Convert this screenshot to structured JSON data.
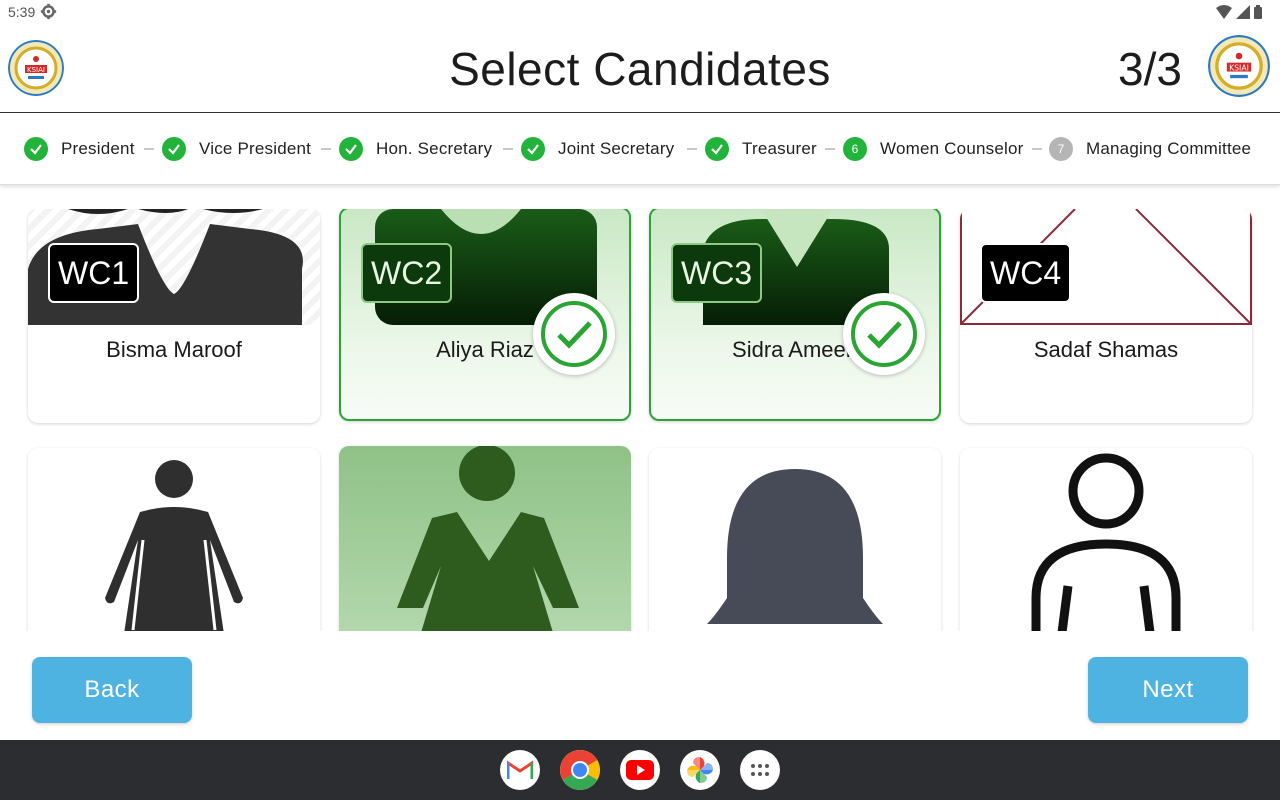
{
  "status_bar": {
    "time": "5:39"
  },
  "header": {
    "title": "Select Candidates",
    "page_count": "3/3"
  },
  "stepper": {
    "steps": [
      {
        "label": "President",
        "state": "done"
      },
      {
        "label": "Vice President",
        "state": "done"
      },
      {
        "label": "Hon. Secretary",
        "state": "done"
      },
      {
        "label": "Joint Secretary",
        "state": "done"
      },
      {
        "label": "Treasurer",
        "state": "done"
      },
      {
        "label": "Women Counselor",
        "state": "active",
        "number": "6"
      },
      {
        "label": "Managing Committee",
        "state": "pending",
        "number": "7"
      }
    ]
  },
  "candidates_row1": [
    {
      "code": "WC1",
      "name": "Bisma Maroof",
      "selected": false
    },
    {
      "code": "WC2",
      "name": "Aliya Riaz",
      "selected": true
    },
    {
      "code": "WC3",
      "name": "Sidra Ameen",
      "selected": true
    },
    {
      "code": "WC4",
      "name": "Sadaf Shamas",
      "selected": false
    }
  ],
  "candidates_row2": [
    {
      "selected": false
    },
    {
      "selected": true
    },
    {
      "selected": false
    },
    {
      "selected": false
    }
  ],
  "buttons": {
    "back": "Back",
    "next": "Next"
  },
  "dock": {
    "apps": [
      "gmail-icon",
      "chrome-icon",
      "youtube-icon",
      "photos-icon",
      "app-drawer-icon"
    ]
  },
  "colors": {
    "accent_green": "#22b33a",
    "button_blue": "#4fb3e2",
    "taskbar": "#2b2d31"
  }
}
